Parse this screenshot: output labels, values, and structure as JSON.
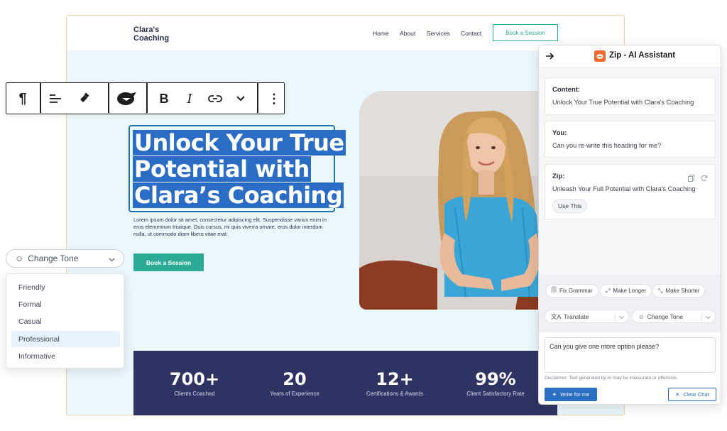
{
  "site": {
    "logo": "Clara's\nCoaching",
    "nav": [
      "Home",
      "About",
      "Services",
      "Contact"
    ],
    "nav_cta": "Book a Session",
    "heading_lines": [
      "Unlock Your True",
      "Potential with",
      "Clara’s Coaching"
    ],
    "paragraph": "Lorem ipsum dolor sit amet, consectetur adipiscing elit. Suspendisse varius enim in eros elementum tristique. Duis cursus, mi quis viverra ornare, eros dolor interdum nulla, ut commodo diam libero vitae erat.",
    "hero_cta": "Book a Session",
    "stats": [
      {
        "num": "700+",
        "label": "Clients Coached"
      },
      {
        "num": "20",
        "label": "Years of Experience"
      },
      {
        "num": "12+",
        "label": "Certifications & Awards"
      },
      {
        "num": "99%",
        "label": "Client Satisfactory Rate"
      }
    ]
  },
  "toolbar": {
    "paragraph_icon": "¶",
    "bold": "B",
    "italic": "I",
    "more": "⋮"
  },
  "tone": {
    "selected": "Change Tone",
    "options": [
      "Friendly",
      "Formal",
      "Casual",
      "Professional",
      "Informative"
    ],
    "active_option": "Professional"
  },
  "assistant": {
    "title": "Zip - AI Assistant",
    "content_label": "Content:",
    "content_text": "Unlock Your True Potential with Clara's Coaching",
    "you_label": "You:",
    "you_text": "Can you re-write this heading for me?",
    "zip_label": "Zip:",
    "zip_text": "Unleash Your Full Potential with Clara's Coaching",
    "use_this": "Use This",
    "actions": [
      "Fix Grammar",
      "Make Longer",
      "Make Shorter"
    ],
    "translate": "Translate",
    "change_tone": "Change Tone",
    "input_value": "Can you give one more option please?",
    "disclaimer": "Disclaimer: Text generated by AI may be inaccurate or offensive.",
    "write_button": "Write for me",
    "clear_button": "Clear Chat"
  },
  "colors": {
    "accent_teal": "#2baa95",
    "selection_blue": "#2b6dc4",
    "stats_bg": "#2f3363",
    "zip_orange": "#f26b2c"
  }
}
